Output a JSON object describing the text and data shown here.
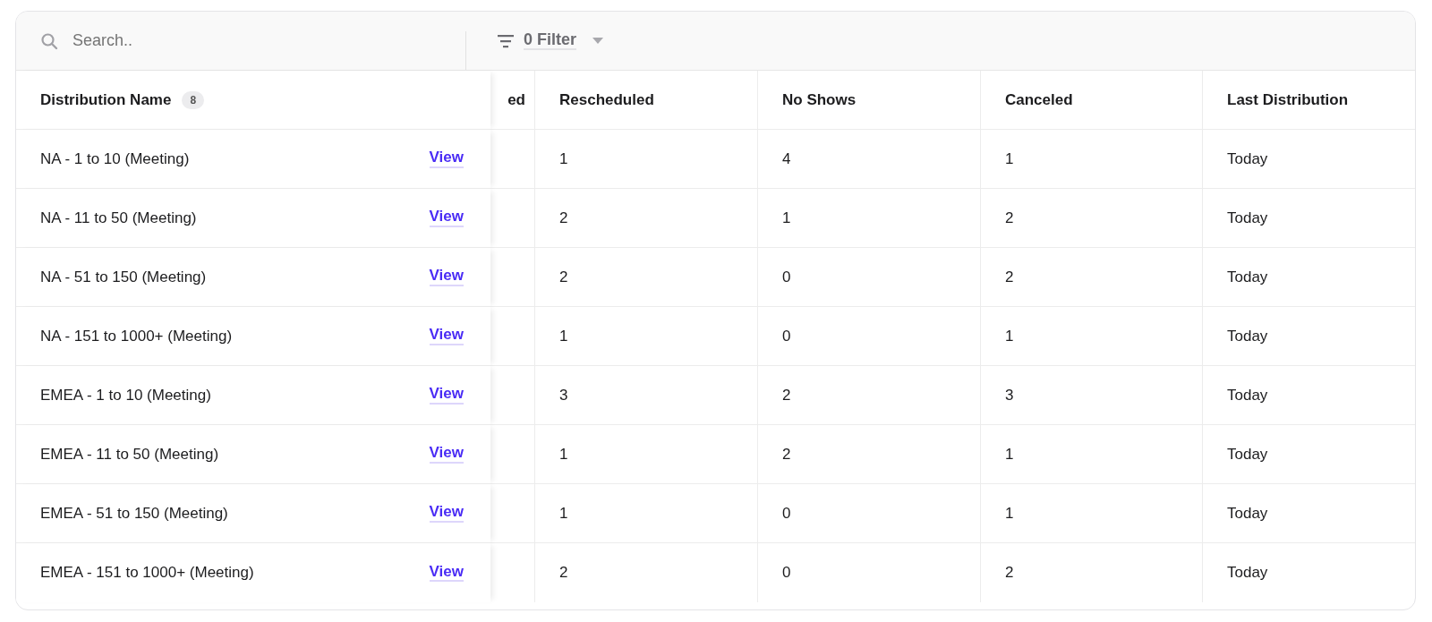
{
  "toolbar": {
    "search": {
      "placeholder": "Search.."
    },
    "filter": {
      "label": "0 Filter"
    }
  },
  "table": {
    "columns": [
      {
        "label": "Distribution Name",
        "count": "8"
      },
      {
        "label": "ed"
      },
      {
        "label": "Rescheduled"
      },
      {
        "label": "No Shows"
      },
      {
        "label": "Canceled"
      },
      {
        "label": "Last Distribution"
      }
    ],
    "rows": [
      {
        "cells": [
          "NA - 1 to 10 (Meeting)",
          "",
          "1",
          "4",
          "1",
          "Today"
        ],
        "link": "View"
      },
      {
        "cells": [
          "NA - 11 to 50 (Meeting)",
          "",
          "2",
          "1",
          "2",
          "Today"
        ],
        "link": "View"
      },
      {
        "cells": [
          "NA - 51 to 150 (Meeting)",
          "",
          "2",
          "0",
          "2",
          "Today"
        ],
        "link": "View"
      },
      {
        "cells": [
          "NA - 151 to 1000+ (Meeting)",
          "",
          "1",
          "0",
          "1",
          "Today"
        ],
        "link": "View"
      },
      {
        "cells": [
          "EMEA - 1 to 10 (Meeting)",
          "",
          "3",
          "2",
          "3",
          "Today"
        ],
        "link": "View"
      },
      {
        "cells": [
          "EMEA - 11 to 50 (Meeting)",
          "",
          "1",
          "2",
          "1",
          "Today"
        ],
        "link": "View"
      },
      {
        "cells": [
          "EMEA - 51 to 150 (Meeting)",
          "",
          "1",
          "0",
          "1",
          "Today"
        ],
        "link": "View"
      },
      {
        "cells": [
          "EMEA - 151 to 1000+ (Meeting)",
          "",
          "2",
          "0",
          "2",
          "Today"
        ],
        "link": "View"
      }
    ]
  }
}
